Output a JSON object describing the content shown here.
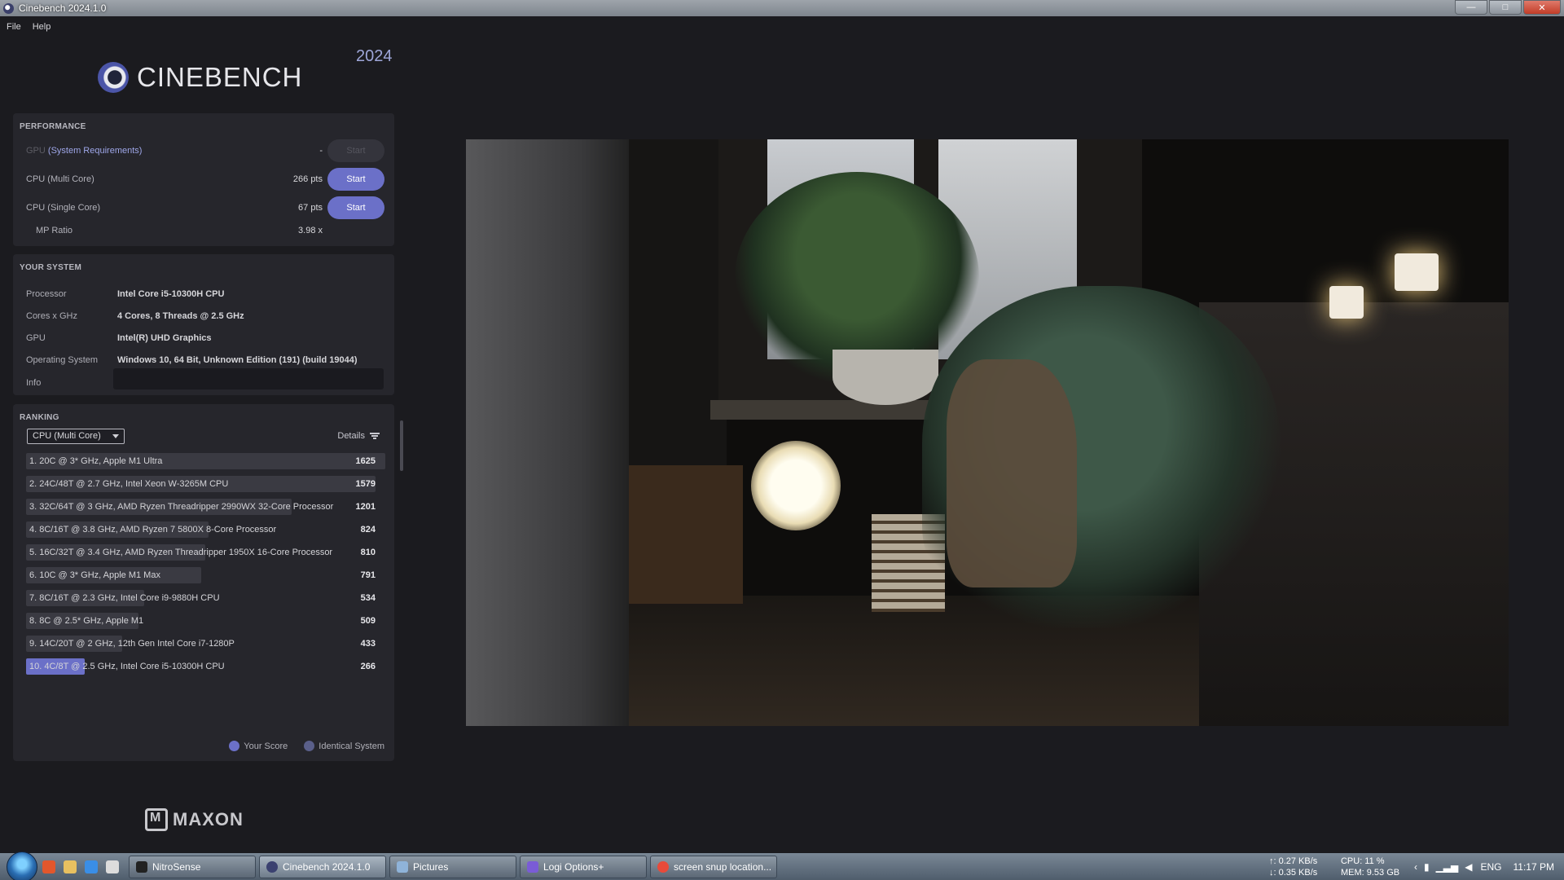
{
  "window": {
    "title": "Cinebench 2024.1.0"
  },
  "menu": [
    "File",
    "Help"
  ],
  "logo": {
    "name": "CINEBENCH",
    "year": "2024"
  },
  "performance": {
    "header": "PERFORMANCE",
    "gpu": {
      "label_prefix": "GPU",
      "label_link": "(System Requirements)",
      "value": "-",
      "button": "Start"
    },
    "multi": {
      "label": "CPU (Multi Core)",
      "value": "266 pts",
      "button": "Start"
    },
    "single": {
      "label": "CPU (Single Core)",
      "value": "67 pts",
      "button": "Start"
    },
    "mp_ratio": {
      "label": "MP Ratio",
      "value": "3.98 x"
    }
  },
  "system": {
    "header": "YOUR SYSTEM",
    "rows": [
      {
        "key": "Processor",
        "value": "Intel Core i5-10300H CPU"
      },
      {
        "key": "Cores x GHz",
        "value": "4 Cores, 8 Threads @ 2.5 GHz"
      },
      {
        "key": "GPU",
        "value": "Intel(R) UHD Graphics"
      },
      {
        "key": "Operating System",
        "value": "Windows 10, 64 Bit, Unknown Edition (191) (build 19044)"
      },
      {
        "key": "Info",
        "value": ""
      }
    ]
  },
  "ranking": {
    "header": "RANKING",
    "dropdown": "CPU (Multi Core)",
    "details": "Details",
    "max_score": 1625,
    "rows": [
      {
        "name": "1. 20C @ 3* GHz, Apple M1 Ultra",
        "score": 1625
      },
      {
        "name": "2. 24C/48T @ 2.7 GHz, Intel Xeon W-3265M CPU",
        "score": 1579
      },
      {
        "name": "3. 32C/64T @ 3 GHz, AMD Ryzen Threadripper 2990WX 32-Core Processor",
        "score": 1201
      },
      {
        "name": "4. 8C/16T @ 3.8 GHz, AMD Ryzen 7 5800X 8-Core Processor",
        "score": 824
      },
      {
        "name": "5. 16C/32T @ 3.4 GHz, AMD Ryzen Threadripper 1950X 16-Core Processor",
        "score": 810
      },
      {
        "name": "6. 10C @ 3* GHz, Apple M1 Max",
        "score": 791
      },
      {
        "name": "7. 8C/16T @ 2.3 GHz, Intel Core i9-9880H CPU",
        "score": 534
      },
      {
        "name": "8. 8C @ 2.5* GHz, Apple M1",
        "score": 509
      },
      {
        "name": "9. 14C/20T @ 2 GHz, 12th Gen Intel Core i7-1280P",
        "score": 433
      },
      {
        "name": "10. 4C/8T @ 2.5 GHz, Intel Core i5-10300H CPU",
        "score": 266,
        "mine": true
      }
    ],
    "legend": {
      "your_score": "Your Score",
      "identical": "Identical System"
    },
    "colors": {
      "mine": "#6b70c8",
      "identical": "#5a5f8a",
      "bar": "#3a3a42"
    }
  },
  "brand": {
    "maxon": "MAXON"
  },
  "taskbar": {
    "buttons": [
      "NitroSense",
      "Cinebench 2024.1.0",
      "Pictures",
      "Logi Options+",
      "screen snup location..."
    ],
    "net_up": "↑: 0.27 KB/s",
    "net_down": "↓: 0.35 KB/s",
    "cpu": "CPU: 11 %",
    "mem": "MEM: 9.53 GB",
    "lang": "ENG",
    "time": "11:17 PM"
  }
}
